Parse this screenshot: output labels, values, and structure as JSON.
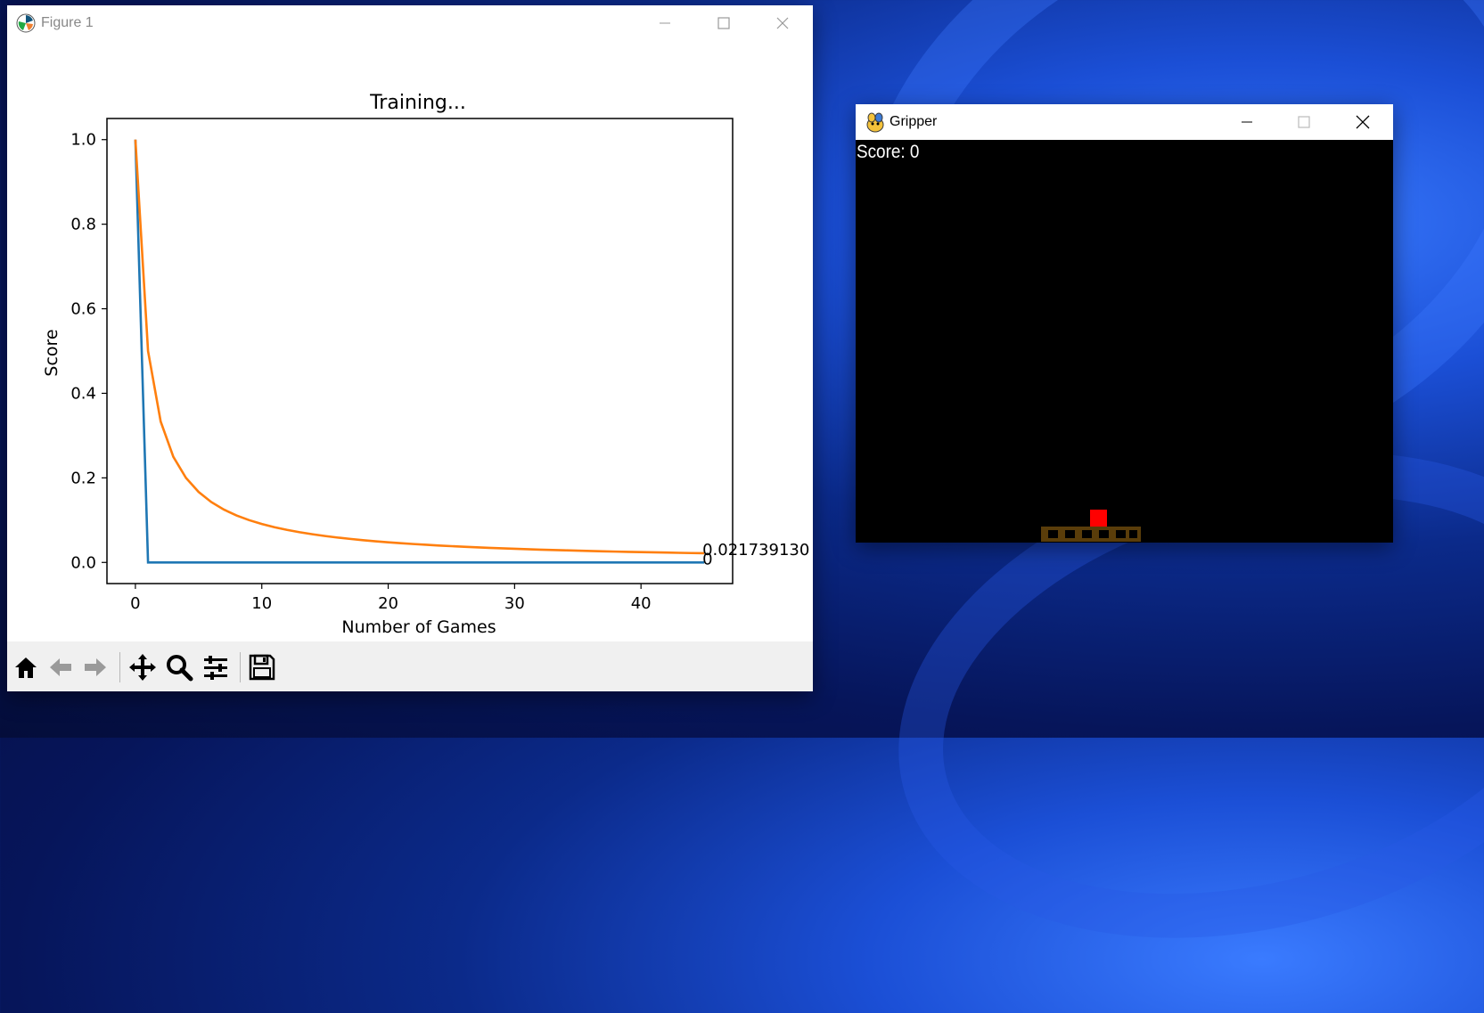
{
  "figure_window": {
    "title": "Figure 1",
    "toolbar": {
      "home": "home-icon",
      "back": "back-arrow-icon",
      "forward": "forward-arrow-icon",
      "pan": "pan-icon",
      "zoom": "zoom-icon",
      "configure": "configure-subplots-icon",
      "save": "save-icon"
    }
  },
  "game_window": {
    "title": "Gripper",
    "score_text": "Score: 0",
    "colors": {
      "background": "#000000",
      "block": "#ff0000",
      "gripper": "#5a3d0a"
    }
  },
  "chart_data": {
    "type": "line",
    "title": "Training...",
    "xlabel": "Number of Games",
    "ylabel": "Score",
    "xlim": [
      -2.25,
      47.25
    ],
    "ylim": [
      -0.05,
      1.05
    ],
    "xticks": [
      0,
      10,
      20,
      30,
      40
    ],
    "yticks": [
      0.0,
      0.2,
      0.4,
      0.6,
      0.8,
      1.0
    ],
    "ytick_labels": [
      "0.0",
      "0.2",
      "0.4",
      "0.6",
      "0.8",
      "1.0"
    ],
    "grid": false,
    "legend": "none",
    "series": [
      {
        "color": "#1f77b4",
        "x": [
          0,
          1,
          2,
          3,
          4,
          5,
          6,
          7,
          8,
          9,
          10,
          11,
          12,
          13,
          14,
          15,
          16,
          17,
          18,
          19,
          20,
          21,
          22,
          23,
          24,
          25,
          26,
          27,
          28,
          29,
          30,
          31,
          32,
          33,
          34,
          35,
          36,
          37,
          38,
          39,
          40,
          41,
          42,
          43,
          44,
          45
        ],
        "y": [
          1,
          0,
          0,
          0,
          0,
          0,
          0,
          0,
          0,
          0,
          0,
          0,
          0,
          0,
          0,
          0,
          0,
          0,
          0,
          0,
          0,
          0,
          0,
          0,
          0,
          0,
          0,
          0,
          0,
          0,
          0,
          0,
          0,
          0,
          0,
          0,
          0,
          0,
          0,
          0,
          0,
          0,
          0,
          0,
          0,
          0
        ]
      },
      {
        "color": "#ff7f0e",
        "x": [
          0,
          1,
          2,
          3,
          4,
          5,
          6,
          7,
          8,
          9,
          10,
          11,
          12,
          13,
          14,
          15,
          16,
          17,
          18,
          19,
          20,
          21,
          22,
          23,
          24,
          25,
          26,
          27,
          28,
          29,
          30,
          31,
          32,
          33,
          34,
          35,
          36,
          37,
          38,
          39,
          40,
          41,
          42,
          43,
          44,
          45
        ],
        "y": [
          1.0,
          0.5,
          0.3333,
          0.25,
          0.2,
          0.1667,
          0.1429,
          0.125,
          0.1111,
          0.1,
          0.0909,
          0.0833,
          0.0769,
          0.0714,
          0.0667,
          0.0625,
          0.0588,
          0.0556,
          0.0526,
          0.05,
          0.0476,
          0.0455,
          0.0435,
          0.0417,
          0.04,
          0.0385,
          0.037,
          0.0357,
          0.0345,
          0.0333,
          0.0323,
          0.0313,
          0.0303,
          0.0294,
          0.0286,
          0.0278,
          0.027,
          0.0263,
          0.0256,
          0.025,
          0.0244,
          0.0238,
          0.0233,
          0.0227,
          0.0222,
          0.0217
        ]
      }
    ],
    "annotations": [
      {
        "text": "0.021739130",
        "x": 45,
        "y": 0.0217
      },
      {
        "text": "0",
        "x": 45,
        "y": 0
      }
    ]
  }
}
